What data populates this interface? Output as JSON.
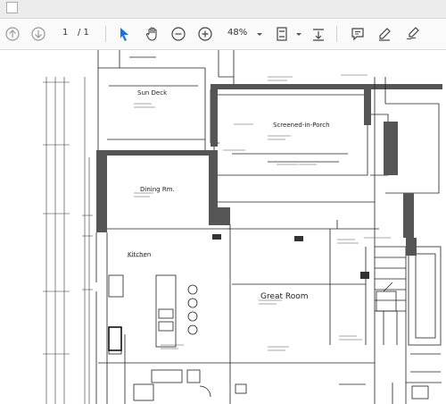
{
  "toolbar": {
    "page_current": "1",
    "page_total": "/ 1",
    "zoom": "48%"
  },
  "drawing": {
    "rooms": {
      "sun_deck": "Sun Deck",
      "screened_in_porch": "Screened-in-Porch",
      "dining_rm": "Dining Rm.",
      "kitchen": "Kitchen",
      "great_room": "Great Room"
    }
  },
  "colors": {
    "select_tool": "#1473e6",
    "wall_fill": "#555555",
    "line": "#222222"
  }
}
